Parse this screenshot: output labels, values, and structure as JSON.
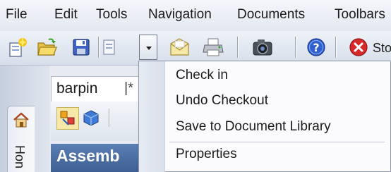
{
  "menubar": {
    "items": [
      "File",
      "Edit",
      "Tools",
      "Navigation",
      "Documents",
      "Toolbars"
    ]
  },
  "toolbar": {
    "stop_label": "Sto",
    "icons": [
      "new-icon",
      "open-folder-icon",
      "save-icon",
      "dropdown-toggle",
      "envelope-icon",
      "printer-icon",
      "camera-icon",
      "help-icon",
      "stop-icon"
    ]
  },
  "document": {
    "tab_label": "barpin",
    "tab_separator": "|*",
    "panel_header": "Assemb",
    "home_tab_label": "Hon"
  },
  "context_menu": {
    "items": [
      "Check in",
      "Undo Checkout",
      "Save to Document Library",
      "Properties"
    ]
  },
  "colors": {
    "menu_bg": "#f4f6fa",
    "toolbar_bg": "#e3e8f1",
    "panel_header_bg": "#4a6ea4",
    "help_blue": "#2f5fd0",
    "stop_red": "#d62a2a"
  }
}
